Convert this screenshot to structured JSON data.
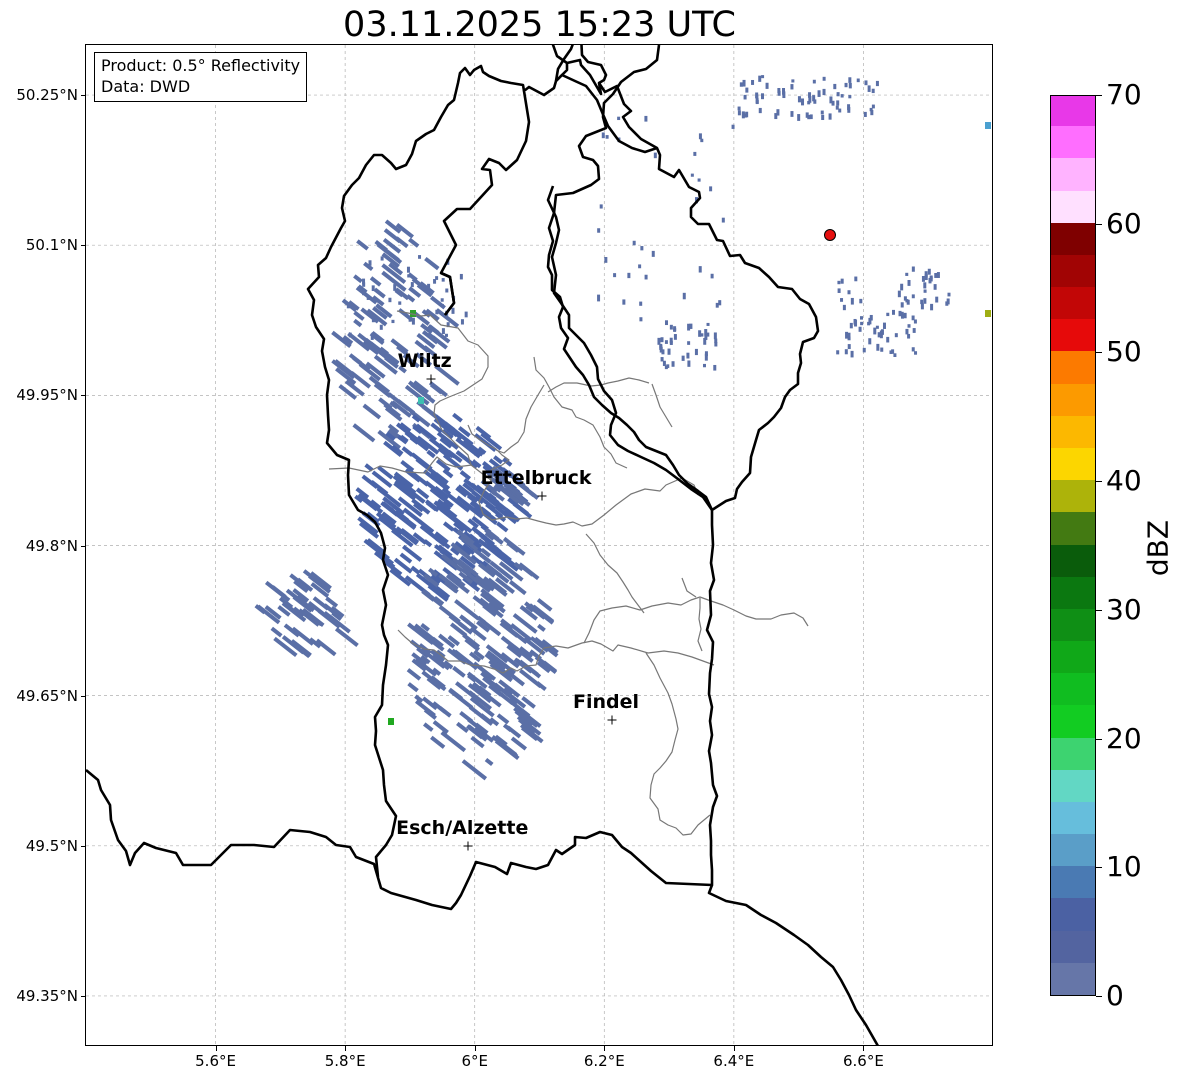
{
  "title": "03.11.2025 15:23 UTC",
  "info_box": {
    "product": "Product: 0.5° Reflectivity",
    "data": "Data: DWD"
  },
  "map": {
    "lon_range": [
      5.4,
      6.8
    ],
    "lat_range": [
      49.3,
      50.3
    ],
    "lat_ticks": [
      {
        "value": 50.25,
        "label": "50.25°N"
      },
      {
        "value": 50.1,
        "label": "50.1°N"
      },
      {
        "value": 49.95,
        "label": "49.95°N"
      },
      {
        "value": 49.8,
        "label": "49.8°N"
      },
      {
        "value": 49.65,
        "label": "49.65°N"
      },
      {
        "value": 49.5,
        "label": "49.5°N"
      },
      {
        "value": 49.35,
        "label": "49.35°N"
      }
    ],
    "lon_ticks": [
      {
        "value": 5.6,
        "label": "5.6°E"
      },
      {
        "value": 5.8,
        "label": "5.8°E"
      },
      {
        "value": 6.0,
        "label": "6°E"
      },
      {
        "value": 6.2,
        "label": "6.2°E"
      },
      {
        "value": 6.4,
        "label": "6.4°E"
      },
      {
        "value": 6.6,
        "label": "6.6°E"
      }
    ],
    "gridlines": true,
    "radar_site": {
      "lon": 6.548,
      "lat": 50.11,
      "color": "#e61010"
    },
    "cities": [
      {
        "name": "Wiltz",
        "lon": 5.932,
        "lat": 49.966
      },
      {
        "name": "Ettelbruck",
        "lon": 6.104,
        "lat": 49.849
      },
      {
        "name": "Findel",
        "lon": 6.212,
        "lat": 49.626
      },
      {
        "name": "Esch/Alzette",
        "lon": 5.99,
        "lat": 49.5
      }
    ],
    "colors": {
      "border": "#000000",
      "cantons": "#777777",
      "grid": "#b0b0b0",
      "echo_weak": "#5a6fa6",
      "echo_strong": "#4a64a8"
    }
  },
  "colorbar": {
    "label": "dBZ",
    "min": 0,
    "max": 70,
    "tick_values": [
      0,
      10,
      20,
      30,
      40,
      50,
      60,
      70
    ],
    "segments": [
      "#6676a8",
      "#5364a0",
      "#4b61a3",
      "#4a7ab3",
      "#5a9ec8",
      "#66bedc",
      "#62d7c4",
      "#3dd370",
      "#12cc22",
      "#10bd20",
      "#10a818",
      "#0f8f15",
      "#0b7810",
      "#0a5c0b",
      "#437a12",
      "#adb30a",
      "#fcd600",
      "#fcb800",
      "#fc9a00",
      "#fc7a00",
      "#e60a0a",
      "#c20606",
      "#a10404",
      "#7f0000",
      "#ffe0ff",
      "#ffb3ff",
      "#ff6eff",
      "#e838e8"
    ]
  }
}
